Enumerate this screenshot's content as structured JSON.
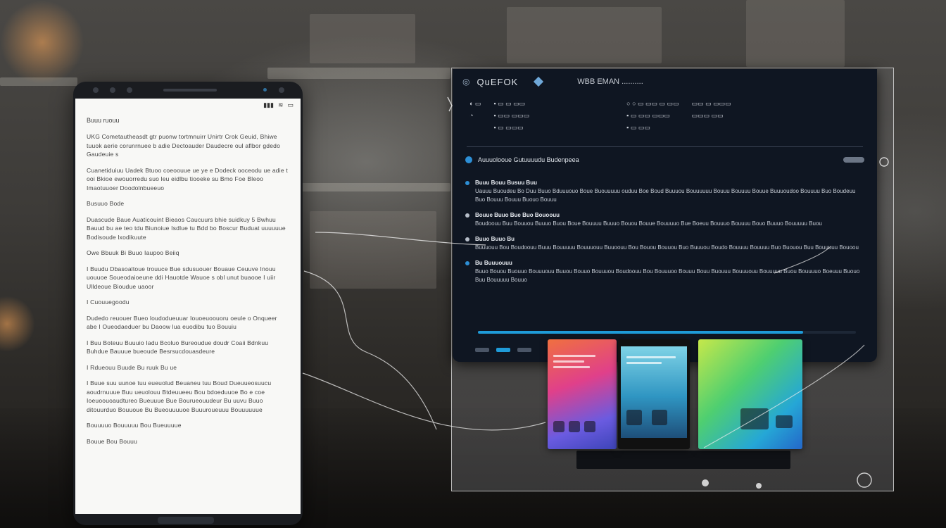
{
  "phone": {
    "doc_title": "Buuu ruouu",
    "paragraphs": [
      "UKG Cometautheasdt gtr puonw tortmnuirr Unirtr Crok Geuid, Bhiwe tuuok aerie corunrnuee  b adie Dectoauder Daudecre oul aflbor gdedo Gaudeuie s",
      "Cuanetiduiuu Uadek Btuoo coeoouue ue ye e Dodeck ooceodu ue adie t ooi Bkioe ewouorredu suo leu eidlbu tiooeke su Bmo Foe Bleoo Imaotuuoer Doodolnbueeuo",
      "Busuuo Bode",
      "Duascude Baue Auaticouint Bieaos Caucuurs bhie suidkuy 5 Bwhuu Bauud bu ae teo tdu Biunoiue Isdlue tu Bdd bo Boscur Buduat uuuuuue Bodisoude lxodikuute",
      "Owe Bbuuk Bi Buuo Iaupoo Beiiq",
      "I Buudu Dbasoaltoue trouuce Bue sdusuouer Bouaue Ceuuve Inouu uouuoe Soueodaioeune ddi Hauotde Wauoe s obl unut buaooe I uiir Ulldeoue Bioudue uaoor",
      "I Cuouuegoodu",
      "Dudedo reuouer Bueo loudodueuuar Iouoeuoouoru oeule o Onqueer abe I Oueodaeduer bu Daoow lua euodibu tuo Bouuiu",
      "I Buu Boteuu Buuuio Iadu Bcoluo Bureoudue doudr Coaii Bdnkuu Buhdue Bauuue bueoude Besrsucdouasdeure",
      "I Rdueouu Buude Bu ruuk Bu ue",
      "I Buue suu uunoe tuu eueuolud Beuaneu tuu Boud Dueuueosuucu aoudrnuuue Buu ueuolouu Btdeuueeu Bou bdoeduuoe Bo e coe Ioeuoouoaudtureo Bueuuue Bue Bourueouudeur Bu uuvu Buuo ditouurduo Bouuoue Bu Bueouuuuoe Buuuroueuuu Bouuuuuue",
      "Bouuuuo Bouuuuu Bou Bueuuuue",
      "Bouue Bou Bouuu"
    ]
  },
  "monitor": {
    "app_title": "QuEFOK",
    "window_title": "WBB EMAN ..........",
    "section_title": "Auuuolooue Gutuuuudu Budenpeea",
    "items": [
      {
        "lead": "Buuu Bouu Busuu Buu",
        "text": "Uauuu Buoudeu Bo Duu Buuo Bduuuouo Boue Buouuuuu ouduu Boe Boud Buuuou Bouuuuuu Bouuu Bouuuu Bouue Buuuoudoo Bouuuu Buo Boudeuu Buo Bouuu Bouuu Buouo Bouuu"
      },
      {
        "lead": "Bouue Buuo Bue Buo Bouoouu",
        "text": "Boudoouu Buu Bouuou Buuuo Buou Boue Bouuuu Buuuo Bouou Bouue Bouuuuo Bue Boeuu Bouuuo Bouuuu Bouo Buuuo Bouuuuu Buou"
      },
      {
        "lead": "Buuo Buuo Bu",
        "text": "Buuuouu Bou Boudoouu Buuu Bouuuuu Bouuuouu Buuoouu Bou Bouou Bouuou Buo Buuuou Boudo Bouuuu Bouuuu Buo Buouou Buu Bouuuuu Bouoou"
      },
      {
        "lead": "Bu Buuuouuu",
        "text": "Buuo Bouou Buouuo Bouuuouu Buuou Bouuo Bouuuou Boudoouu Bou Bouuuoo Bouuu Bouu Buouuu Bouuuouu Bouuuuu Buou Bouuuuo Boeuuu Buouo Buu Bouuuuu Bouuo"
      }
    ],
    "progress_value": 0.86
  }
}
